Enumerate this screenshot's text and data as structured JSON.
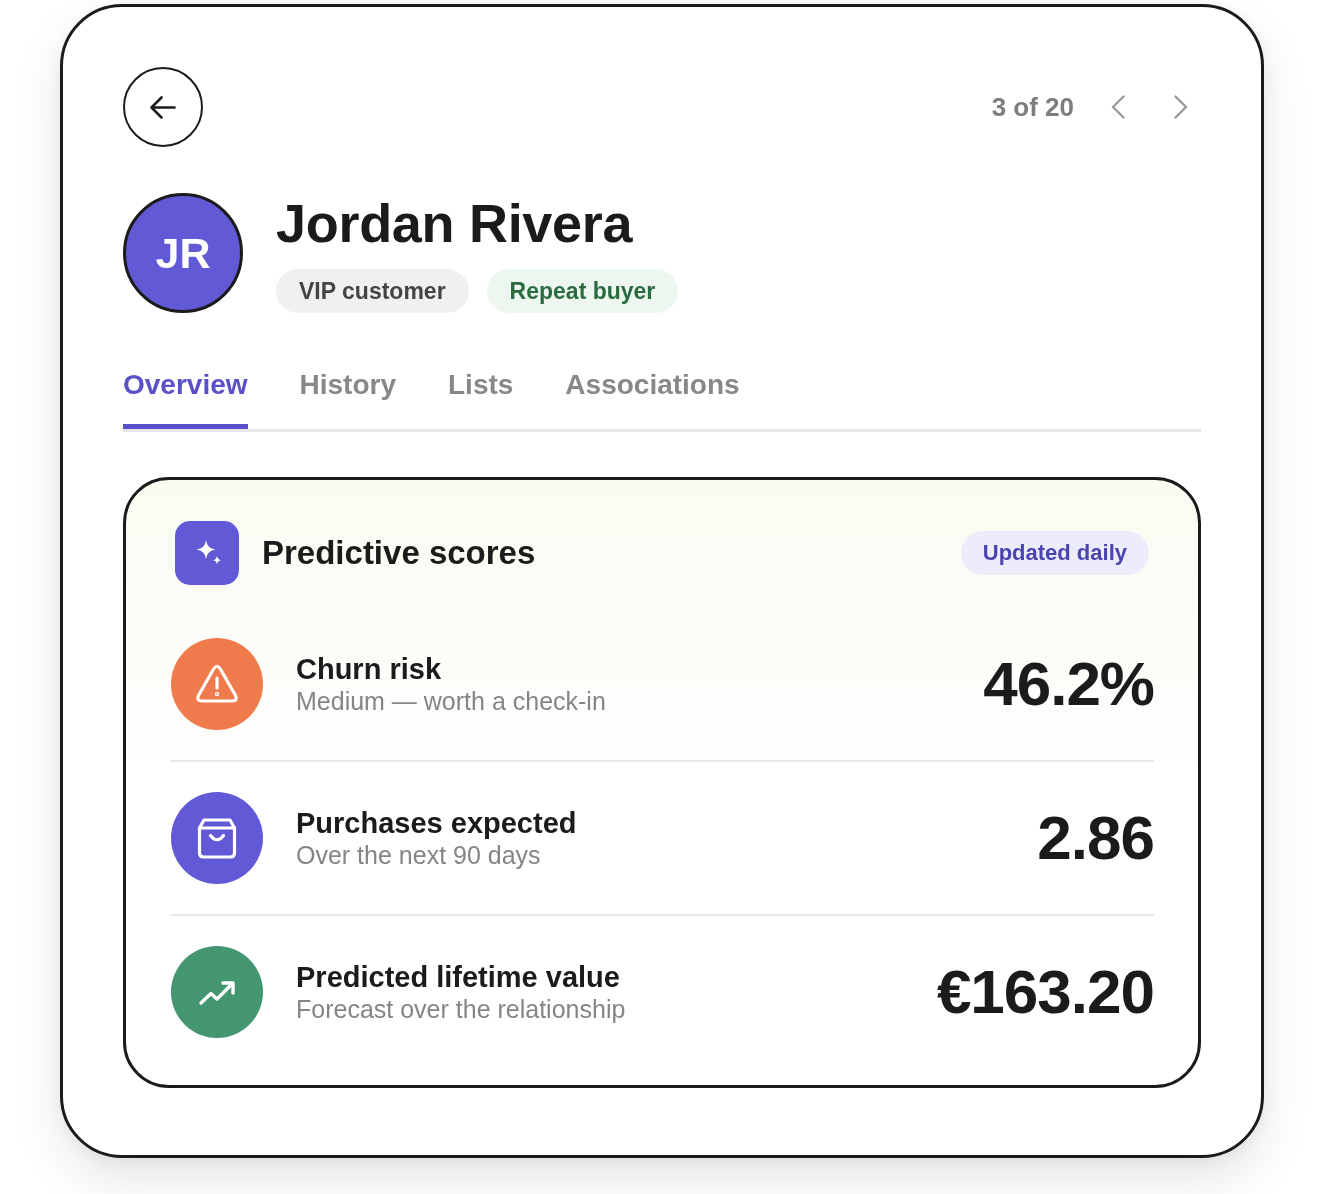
{
  "pager": {
    "position": "3 of 20"
  },
  "profile": {
    "initials": "JR",
    "name": "Jordan Rivera",
    "tags": [
      {
        "label": "VIP customer",
        "kind": "neutral"
      },
      {
        "label": "Repeat buyer",
        "kind": "positive"
      }
    ]
  },
  "tabs": [
    {
      "label": "Overview",
      "selected": true
    },
    {
      "label": "History",
      "selected": false
    },
    {
      "label": "Lists",
      "selected": false
    },
    {
      "label": "Associations",
      "selected": false
    }
  ],
  "scores": {
    "title": "Predictive scores",
    "badge": "Updated daily",
    "metrics": [
      {
        "kind": "risk",
        "color": "#ef7a4c",
        "title": "Churn risk",
        "subtitle": "Medium — worth a check-in",
        "value": "46.2%"
      },
      {
        "kind": "purchases",
        "color": "#6159d6",
        "title": "Purchases expected",
        "subtitle": "Over the next 90 days",
        "value": "2.86"
      },
      {
        "kind": "value",
        "color": "#449670",
        "title": "Predicted lifetime value",
        "subtitle": "Forecast over the relationship",
        "value": "€163.20"
      }
    ]
  }
}
